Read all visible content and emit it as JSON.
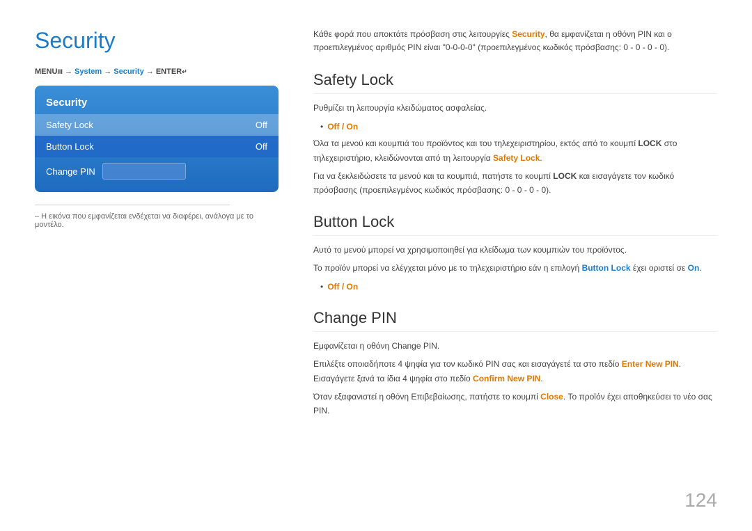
{
  "left": {
    "title": "Security",
    "menuPath": "MENU  → System → Security → ENTER",
    "panel": {
      "title": "Security",
      "rows": [
        {
          "label": "Safety Lock",
          "value": "Off",
          "state": "selected"
        },
        {
          "label": "Button Lock",
          "value": "Off",
          "state": "active"
        },
        {
          "label": "Change PIN",
          "value": "",
          "state": "normal"
        }
      ]
    },
    "footnote": "– Η εικόνα που εμφανίζεται ενδέχεται να διαφέρει, ανάλογα με το μοντέλο."
  },
  "right": {
    "intro": "Κάθε φορά που αποκτάτε πρόσβαση στις λειτουργίες Security, θα εμφανίζεται η οθόνη PIN και ο προεπιλεγμένος αριθμός PIN είναι \"0-0-0-0\" (προεπιλεγμένος κωδικός πρόσβασης: 0 - 0 - 0 - 0).",
    "sections": [
      {
        "title": "Safety Lock",
        "paragraphs": [
          "Ρυθμίζει τη λειτουργία κλειδώματος ασφαλείας.",
          "• Off / On",
          "Όλα τα μενού και κουμπιά του προϊόντος και του τηλεχειριστηρίου, εκτός από το κουμπί LOCK στο τηλεχειριστήριο, κλειδώνονται από τη λειτουργία Safety Lock.",
          "Για να ξεκλειδώσετε τα μενού και τα κουμπιά, πατήστε το κουμπί LOCK και εισαγάγετε τον κωδικό πρόσβασης (προεπιλεγμένος κωδικός πρόσβασης: 0 - 0 - 0 - 0)."
        ]
      },
      {
        "title": "Button Lock",
        "paragraphs": [
          "Αυτό το μενού μπορεί να χρησιμοποιηθεί για κλείδωμα των κουμπιών του προϊόντος.",
          "Το προϊόν μπορεί να ελέγχεται μόνο με το τηλεχειριστήριο εάν η επιλογή Button Lock έχει οριστεί σε On.",
          "• Off / On"
        ]
      },
      {
        "title": "Change PIN",
        "paragraphs": [
          "Εμφανίζεται η οθόνη Change PIN.",
          "Επιλέξτε οποιαδήποτε 4 ψηφία για τον κωδικό PIN σας και εισαγάγετέ τα στο πεδίο Enter New PIN. Εισαγάγετε ξανά τα ίδια 4 ψηφία στο πεδίο Confirm New PIN.",
          "Όταν εξαφανιστεί η οθόνη Επιβεβαίωσης, πατήστε το κουμπί Close. Το προϊόν έχει αποθηκεύσει το νέο σας PIN."
        ]
      }
    ]
  },
  "pageNumber": "124"
}
